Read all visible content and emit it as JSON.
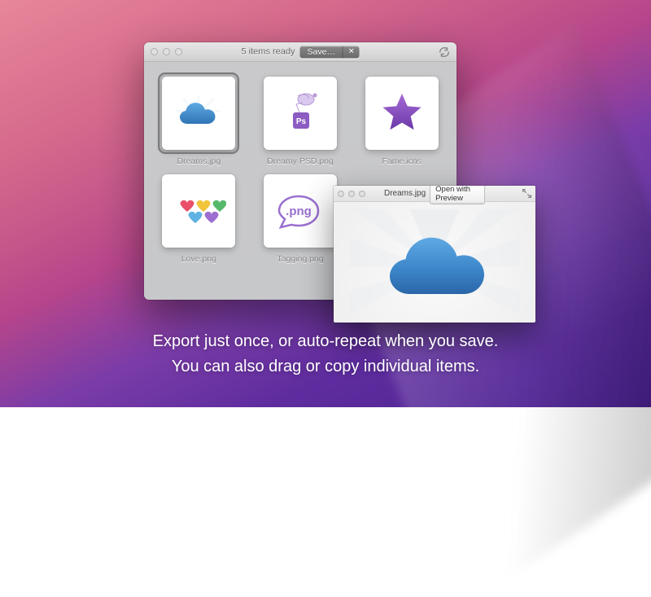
{
  "tagline": {
    "line1": "Export just once, or auto-repeat when you save.",
    "line2": "You can also drag or copy individual items."
  },
  "mainWindow": {
    "status": "5 items ready",
    "saveLabel": "Save…",
    "items": [
      {
        "label": "Dreams.jpg",
        "icon": "cloud",
        "selected": true
      },
      {
        "label": "Dreamy PSD.png",
        "icon": "psd",
        "selected": false
      },
      {
        "label": "Fame.icns",
        "icon": "star",
        "selected": false
      },
      {
        "label": "Love.png",
        "icon": "hearts",
        "selected": false
      },
      {
        "label": "Tagging.png",
        "icon": "pngtag",
        "selected": false
      }
    ]
  },
  "previewWindow": {
    "title": "Dreams.jpg",
    "openWithLabel": "Open with Preview"
  }
}
